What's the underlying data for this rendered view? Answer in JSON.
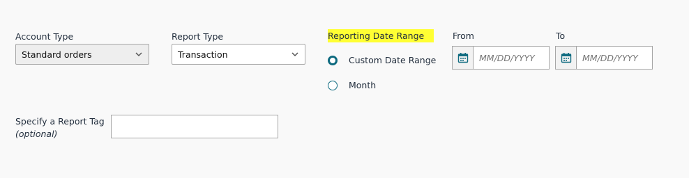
{
  "account_type": {
    "label": "Account Type",
    "value": "Standard orders"
  },
  "report_type": {
    "label": "Report Type",
    "value": "Transaction"
  },
  "date_range": {
    "label": "Reporting Date Range",
    "options": [
      {
        "label": "Custom Date Range",
        "checked": true
      },
      {
        "label": "Month",
        "checked": false
      }
    ]
  },
  "from": {
    "label": "From",
    "placeholder": "MM/DD/YYYY"
  },
  "to": {
    "label": "To",
    "placeholder": "MM/DD/YYYY"
  },
  "report_tag": {
    "label": "Specify a Report Tag",
    "sub_label": "(optional)",
    "value": ""
  },
  "colors": {
    "accent": "#0f6b80",
    "highlight": "#ffff33",
    "border": "#a6a6a6"
  }
}
